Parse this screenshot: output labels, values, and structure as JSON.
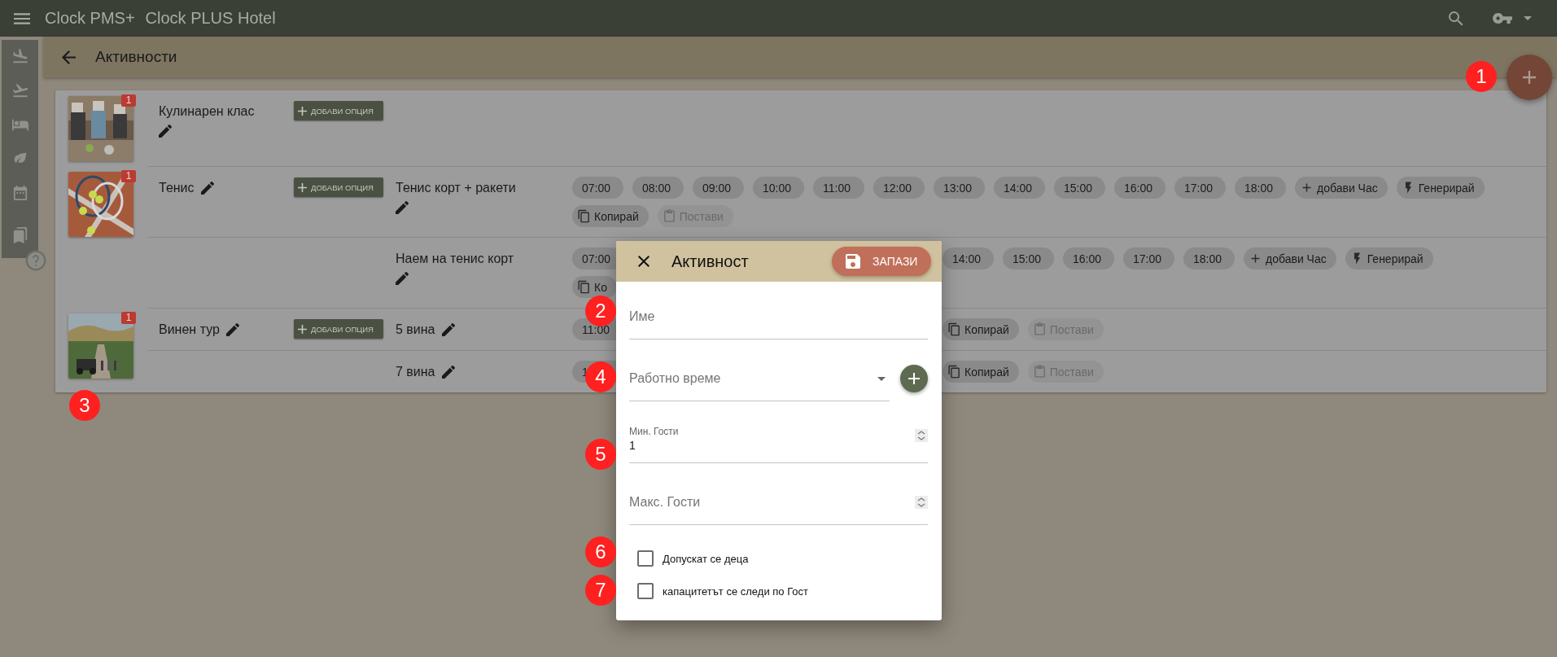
{
  "app_bar": {
    "product": "Clock PMS+",
    "property": "Clock PLUS Hotel"
  },
  "toolbar": {
    "title": "Активности"
  },
  "activities": [
    {
      "name": "Кулинарен клас",
      "badge": "1",
      "add_option": "ДОБАВИ ОПЦИЯ"
    },
    {
      "name": "Тенис",
      "badge": "1",
      "add_option": "ДОБАВИ ОПЦИЯ",
      "options": [
        {
          "name": "Тенис корт + ракети",
          "chips": [
            {
              "kind": "time",
              "label": "07:00",
              "disabled": false
            },
            {
              "kind": "time",
              "label": "08:00",
              "disabled": false
            },
            {
              "kind": "time",
              "label": "09:00",
              "disabled": false
            },
            {
              "kind": "time",
              "label": "10:00",
              "disabled": false
            },
            {
              "kind": "time",
              "label": "11:00",
              "disabled": false
            },
            {
              "kind": "time",
              "label": "12:00",
              "disabled": false
            },
            {
              "kind": "time",
              "label": "13:00",
              "disabled": false
            },
            {
              "kind": "time",
              "label": "14:00",
              "disabled": false
            },
            {
              "kind": "time",
              "label": "15:00",
              "disabled": false
            },
            {
              "kind": "time",
              "label": "16:00",
              "disabled": false
            },
            {
              "kind": "time",
              "label": "17:00",
              "disabled": false
            },
            {
              "kind": "time",
              "label": "18:00",
              "disabled": false
            },
            {
              "kind": "add",
              "label": "добави Час",
              "disabled": false
            },
            {
              "kind": "generate",
              "label": "Генерирай",
              "disabled": false
            },
            {
              "kind": "copy",
              "label": "Копирай",
              "disabled": false
            },
            {
              "kind": "paste",
              "label": "Постави",
              "disabled": true
            }
          ]
        },
        {
          "name": "Наем на тенис корт",
          "chips": [
            {
              "kind": "time",
              "label": "07:00",
              "disabled": false
            },
            {
              "kind": "copy",
              "label": "Ко",
              "disabled": false
            }
          ],
          "chips_right": [
            {
              "kind": "time",
              "label": "14:00",
              "disabled": false
            },
            {
              "kind": "time",
              "label": "15:00",
              "disabled": false
            },
            {
              "kind": "time",
              "label": "16:00",
              "disabled": false
            },
            {
              "kind": "time",
              "label": "17:00",
              "disabled": false
            },
            {
              "kind": "time",
              "label": "18:00",
              "disabled": false
            },
            {
              "kind": "add",
              "label": "добави Час",
              "disabled": false
            },
            {
              "kind": "generate",
              "label": "Генерирай",
              "disabled": false
            }
          ]
        }
      ]
    },
    {
      "name": "Винен тур",
      "badge": "1",
      "add_option": "ДОБАВИ ОПЦИЯ",
      "options": [
        {
          "name": "5 вина",
          "chips": [
            {
              "kind": "time",
              "label": "11:00",
              "disabled": false
            }
          ],
          "chips_right": [
            {
              "kind": "copy",
              "label": "Копирай",
              "disabled": false
            },
            {
              "kind": "paste",
              "label": "Постави",
              "disabled": true
            }
          ]
        },
        {
          "name": "7 вина",
          "chips": [
            {
              "kind": "time",
              "label": "1",
              "disabled": false
            }
          ],
          "chips_right": [
            {
              "kind": "copy",
              "label": "Копирай",
              "disabled": false
            },
            {
              "kind": "paste",
              "label": "Постави",
              "disabled": true
            }
          ]
        }
      ]
    }
  ],
  "dialog": {
    "title": "Активност",
    "save": "ЗАПАЗИ",
    "fields": [
      {
        "kind": "text",
        "placeholder": "Име"
      },
      {
        "kind": "select",
        "placeholder": "Работно време"
      },
      {
        "kind": "number",
        "label": "Мин. Гости",
        "value": "1"
      },
      {
        "kind": "number",
        "placeholder": "Макс. Гости"
      }
    ],
    "checkboxes": [
      {
        "label": "Допускат се деца",
        "checked": false
      },
      {
        "label": "капацитетът се следи по Гост",
        "checked": false
      }
    ]
  },
  "annotations": [
    "1",
    "2",
    "3",
    "4",
    "5",
    "6",
    "7"
  ]
}
